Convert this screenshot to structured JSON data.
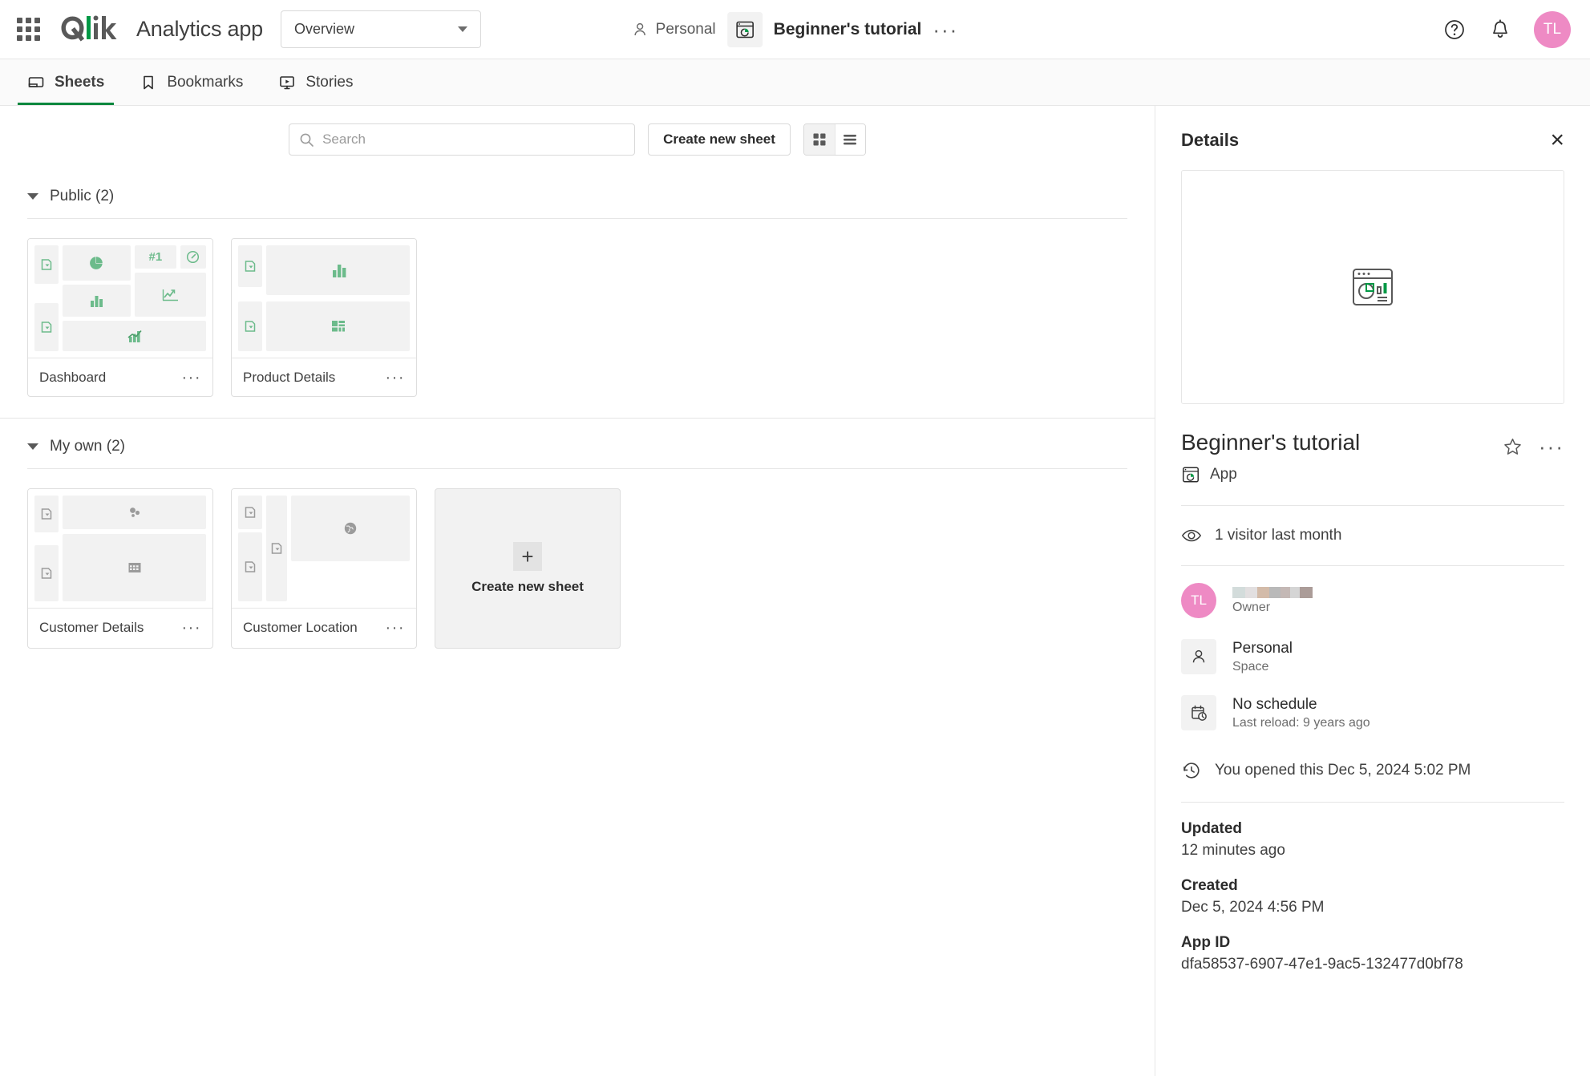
{
  "topbar": {
    "waffle_label": "app-launcher",
    "brand": "Qlik",
    "app_kind": "Analytics app",
    "overview_value": "Overview",
    "space_name": "Personal",
    "app_title": "Beginner's tutorial",
    "more_dots": "···",
    "avatar_initials": "TL"
  },
  "tabs": [
    {
      "label": "Sheets",
      "icon": "sheet-icon",
      "active": true
    },
    {
      "label": "Bookmarks",
      "icon": "bookmark-icon",
      "active": false
    },
    {
      "label": "Stories",
      "icon": "story-icon",
      "active": false
    }
  ],
  "toolbar": {
    "search_placeholder": "Search",
    "search_value": "",
    "create_sheet_label": "Create new sheet",
    "grid_view_active": true
  },
  "sections": [
    {
      "title": "Public (2)",
      "sheets": [
        {
          "name": "Dashboard",
          "dots": "···"
        },
        {
          "name": "Product Details",
          "dots": "···"
        }
      ]
    },
    {
      "title": "My own (2)",
      "sheets": [
        {
          "name": "Customer Details",
          "dots": "···"
        },
        {
          "name": "Customer Location",
          "dots": "···"
        }
      ],
      "create_label": "Create new sheet",
      "create_plus": "+"
    }
  ],
  "details": {
    "panel_title": "Details",
    "close_label": "×",
    "app_name": "Beginner's tutorial",
    "app_type": "App",
    "more_dots": "···",
    "visitors": "1 visitor last month",
    "owner": {
      "initials": "TL",
      "label": "Owner",
      "redacted": true,
      "redact_colors": [
        "#d3dcdb",
        "#e2dfe0",
        "#d3bba9",
        "#b9b9b9",
        "#c4b8b5",
        "#d5d5d5",
        "#ab9c98"
      ]
    },
    "space": {
      "name": "Personal",
      "sub": "Space"
    },
    "schedule": {
      "name": "No schedule",
      "sub": "Last reload: 9 years ago"
    },
    "opened": "You opened this Dec 5, 2024 5:02 PM",
    "updated": {
      "key": "Updated",
      "value": "12 minutes ago"
    },
    "created": {
      "key": "Created",
      "value": "Dec 5, 2024 4:56 PM"
    },
    "app_id": {
      "key": "App ID",
      "value": "dfa58537-6907-47e1-9ac5-132477d0bf78"
    }
  },
  "colors": {
    "brand_green": "#009845",
    "chart_green": "#6cbb8b",
    "accent_pink": "#ee8ac4",
    "tile_gray": "#f2f2f2"
  }
}
